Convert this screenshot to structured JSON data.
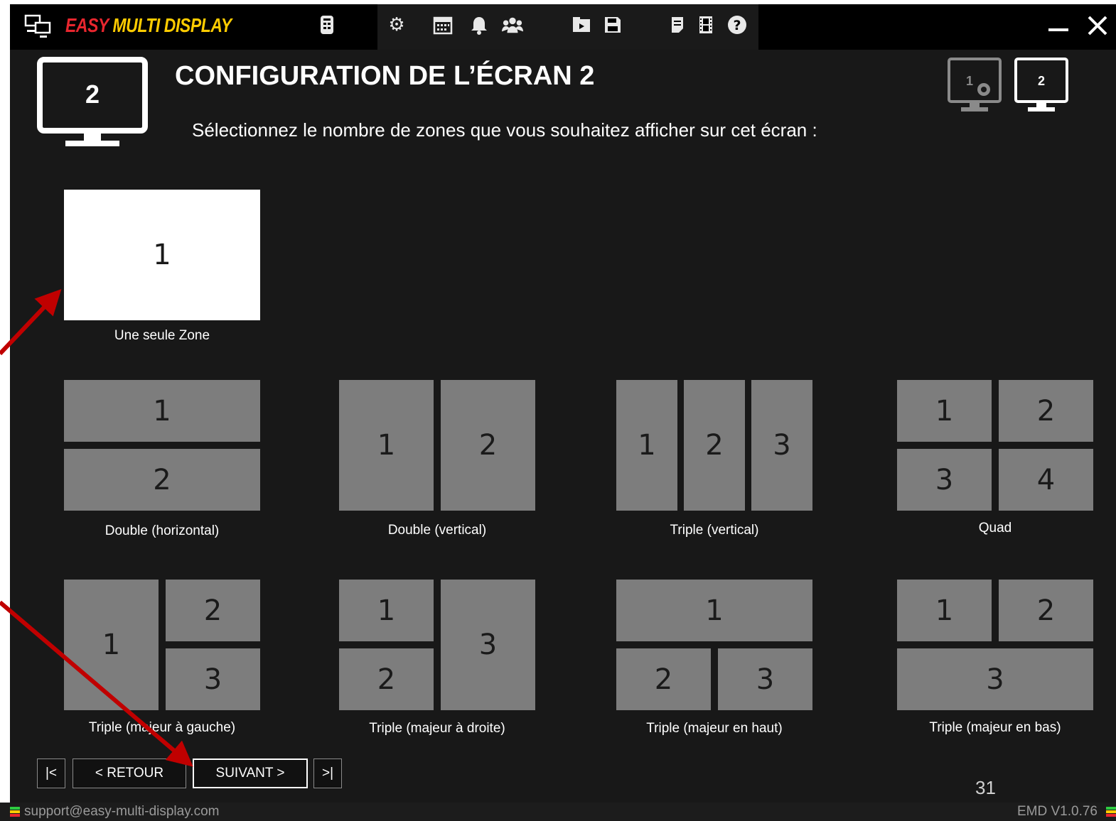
{
  "app": {
    "name_part1": "EASY ",
    "name_part2": "MULTI DISPLAY"
  },
  "toolbar": {
    "icons": [
      "remote-control-icon",
      "gear-icon",
      "calendar-icon",
      "bell-icon",
      "group-icon",
      "open-folder-icon",
      "save-icon",
      "notes-icon",
      "film-icon",
      "help-icon"
    ],
    "minimize": "minimize-icon",
    "close": "close-icon"
  },
  "header": {
    "screen_number": "2",
    "title": "CONFIGURATION DE L’ÉCRAN 2",
    "subtitle": "Sélectionnez le nombre de zones que vous souhaitez afficher sur cet écran :",
    "screen_selector": [
      {
        "label": "1",
        "icon": "monitor-gear-icon",
        "selected": false
      },
      {
        "label": "2",
        "icon": "monitor-icon",
        "selected": true
      }
    ]
  },
  "layouts": [
    {
      "label": "Une seule Zone",
      "zones": [
        "1"
      ],
      "selected": true
    },
    {
      "label": "Double (horizontal)",
      "zones": [
        "1",
        "2"
      ]
    },
    {
      "label": "Double (vertical)",
      "zones": [
        "1",
        "2"
      ]
    },
    {
      "label": "Triple (vertical)",
      "zones": [
        "1",
        "2",
        "3"
      ]
    },
    {
      "label": "Quad",
      "zones": [
        "1",
        "2",
        "3",
        "4"
      ]
    },
    {
      "label": "Triple (majeur à gauche)",
      "zones": [
        "1",
        "2",
        "3"
      ]
    },
    {
      "label": "Triple (majeur à droite)",
      "zones": [
        "1",
        "2",
        "3"
      ]
    },
    {
      "label": "Triple (majeur en haut)",
      "zones": [
        "1",
        "2",
        "3"
      ]
    },
    {
      "label": "Triple (majeur en bas)",
      "zones": [
        "1",
        "2",
        "3"
      ]
    }
  ],
  "navigation": {
    "first": "|<",
    "back": "< RETOUR",
    "next": "SUIVANT >",
    "last": ">|"
  },
  "page_number": "31",
  "statusbar": {
    "email": "support@easy-multi-display.com",
    "version": "EMD V1.0.76"
  },
  "colors": {
    "brand_red": "#e8262e",
    "brand_yellow": "#ffcc00",
    "zone_gray": "#7d7d7d",
    "annotation_arrow": "#c00000"
  }
}
